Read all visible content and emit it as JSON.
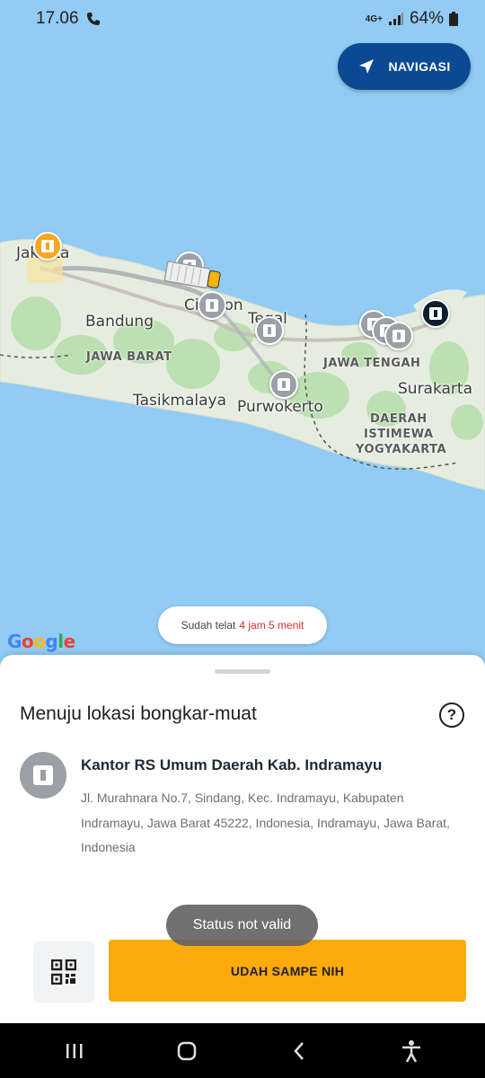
{
  "status_bar": {
    "time": "17.06",
    "network": "4G+",
    "battery": "64%"
  },
  "navigation_button": {
    "label": "NAVIGASI"
  },
  "map": {
    "cities": [
      "Jakarta",
      "Bandung",
      "Cirebon",
      "Tegal",
      "Tasikmalaya",
      "Purwokerto",
      "Surakarta"
    ],
    "regions": [
      "JAWA BARAT",
      "JAWA TENGAH",
      "DAERAH",
      "ISTIMEWA",
      "YOGYAKARTA"
    ],
    "attribution": "Google"
  },
  "late_notice": {
    "prefix": "Sudah telat",
    "duration": "4 jam 5 menit"
  },
  "sheet": {
    "title": "Menuju lokasi bongkar-muat",
    "help_label": "?",
    "location": {
      "name": "Kantor RS Umum Daerah Kab. Indramayu",
      "address": "Jl. Murahnara No.7, Sindang, Kec. Indramayu, Kabupaten Indramayu, Jawa Barat 45222, Indonesia, Indramayu, Jawa Barat, Indonesia"
    },
    "primary_button": "UDAH SAMPE NIH",
    "toast": "Status not valid"
  },
  "colors": {
    "accent": "#fcaa0c",
    "nav_button": "#0b4a92",
    "late_text": "#d0302a"
  }
}
